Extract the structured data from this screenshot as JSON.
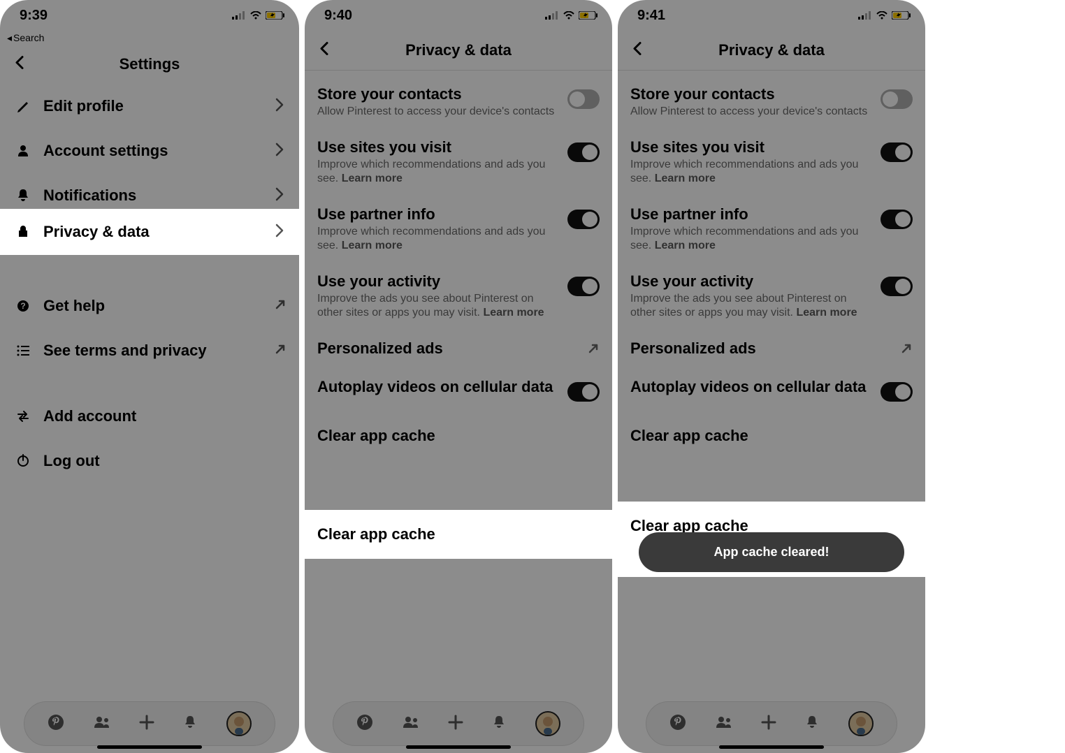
{
  "screen1": {
    "status": {
      "time": "9:39",
      "back_to": "Search"
    },
    "header": {
      "title": "Settings"
    },
    "rows": {
      "edit_profile": "Edit profile",
      "account_settings": "Account settings",
      "notifications": "Notifications",
      "privacy_data": "Privacy & data",
      "get_help": "Get help",
      "terms_privacy": "See terms and privacy",
      "add_account": "Add account",
      "log_out": "Log out"
    }
  },
  "screen2": {
    "status": {
      "time": "9:40"
    },
    "header": {
      "title": "Privacy & data"
    },
    "items": {
      "store_contacts": {
        "title": "Store your contacts",
        "sub": "Allow Pinterest to access your device's contacts",
        "on": false
      },
      "use_sites": {
        "title": "Use sites you visit",
        "sub": "Improve which recommendations and ads you see.",
        "learn_more": "Learn more",
        "on": true
      },
      "partner_info": {
        "title": "Use partner info",
        "sub": "Improve which recommendations and ads you see.",
        "learn_more": "Learn more",
        "on": true
      },
      "activity": {
        "title": "Use your activity",
        "sub": "Improve the ads you see about Pinterest on other sites or apps you may visit.",
        "learn_more": "Learn more",
        "on": true
      },
      "personalized_ads": {
        "title": "Personalized ads"
      },
      "autoplay": {
        "title": "Autoplay videos on cellular data",
        "on": true
      },
      "clear_cache": {
        "title": "Clear app cache"
      }
    }
  },
  "screen3": {
    "status": {
      "time": "9:41"
    },
    "header": {
      "title": "Privacy & data"
    },
    "toast": "App cache cleared!",
    "items": {
      "store_contacts": {
        "title": "Store your contacts",
        "sub": "Allow Pinterest to access your device's contacts",
        "on": false
      },
      "use_sites": {
        "title": "Use sites you visit",
        "sub": "Improve which recommendations and ads you see.",
        "learn_more": "Learn more",
        "on": true
      },
      "partner_info": {
        "title": "Use partner info",
        "sub": "Improve which recommendations and ads you see.",
        "learn_more": "Learn more",
        "on": true
      },
      "activity": {
        "title": "Use your activity",
        "sub": "Improve the ads you see about Pinterest on other sites or apps you may visit.",
        "learn_more": "Learn more",
        "on": true
      },
      "personalized_ads": {
        "title": "Personalized ads"
      },
      "autoplay": {
        "title": "Autoplay videos on cellular data",
        "on": true
      },
      "clear_cache": {
        "title": "Clear app cache"
      }
    }
  },
  "icons": {
    "back_to_label": "◂ Search"
  }
}
